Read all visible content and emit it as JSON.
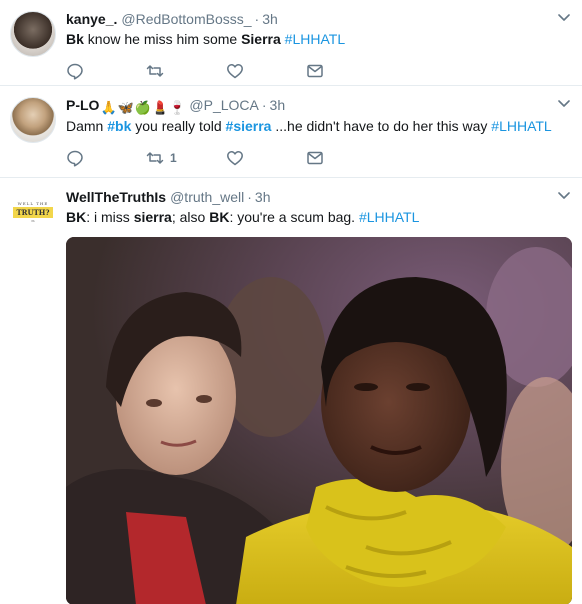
{
  "tweets": [
    {
      "display_name": "kanye_.",
      "handle": "@RedBottomBosss_",
      "dot": "·",
      "time": "3h",
      "text": {
        "part1": "Bk",
        "part2": " know he miss him some ",
        "part3": "Sierra",
        "part4": " ",
        "hashtag": "#LHHATL"
      },
      "actions": {
        "reply": "",
        "retweet": "",
        "like": "",
        "dm": ""
      }
    },
    {
      "display_name": "P-LO",
      "display_emojis": [
        "🙏",
        "🦋",
        "🍏",
        "💄",
        "🍷"
      ],
      "handle": "@P_LOCA",
      "dot": "·",
      "time": "3h",
      "text": {
        "part1": "Damn ",
        "hashtag1": "#bk",
        "part2": " you really told ",
        "hashtag2": "#sierra",
        "part3": "  ...he didn't have to do her this way ",
        "hashtag3": "#LHHATL"
      },
      "actions": {
        "reply": "",
        "retweet": "1",
        "like": "",
        "dm": ""
      }
    },
    {
      "display_name": "WellTheTruthIs",
      "handle": "@truth_well",
      "dot": "·",
      "time": "3h",
      "avatar_logo": {
        "top": "WELL THE",
        "main": "TRUTH?",
        "sub": "IS"
      },
      "text": {
        "part1": "BK",
        "part2": ": i miss ",
        "part3": "sierra",
        "part4": "; also ",
        "part5": "BK",
        "part6": ": you're a scum bag. ",
        "hashtag": "#LHHATL"
      },
      "media": {
        "type": "gif-still",
        "description_icon": "image"
      }
    }
  ],
  "colors": {
    "link": "#1b95e0",
    "muted": "#657786",
    "text": "#14171a",
    "border": "#e6ecf0"
  },
  "icons": [
    "reply-icon",
    "retweet-icon",
    "like-icon",
    "direct-message-icon",
    "caret-down-icon"
  ]
}
